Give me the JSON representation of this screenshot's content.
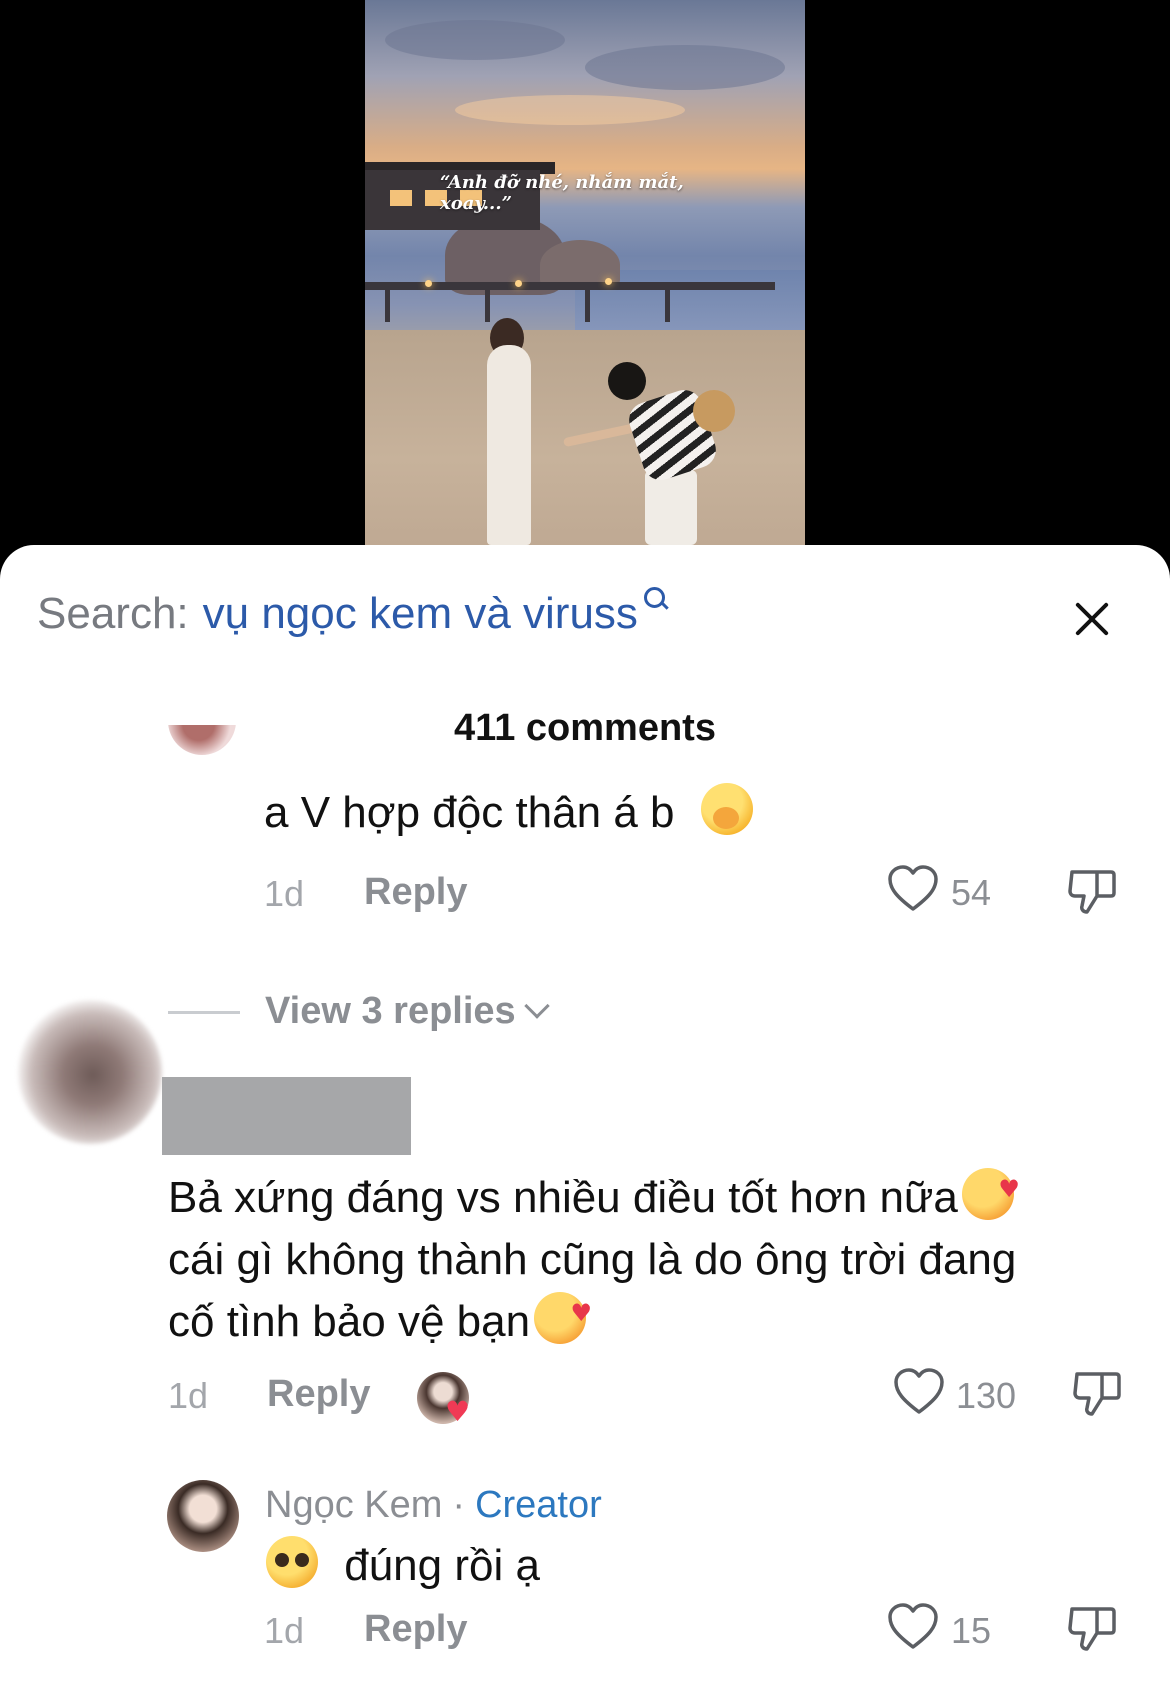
{
  "video": {
    "caption": "“Anh đỡ nhé, nhắm mắt, xoay...”"
  },
  "search": {
    "prefix": "Search:",
    "query": "vụ ngọc kem và viruss"
  },
  "comments_header": {
    "count_label": "411 comments"
  },
  "comments": [
    {
      "text": "a V hợp độc thân á b",
      "emoji": "face-with-hand-over-mouth",
      "time": "1d",
      "reply_label": "Reply",
      "likes": "54"
    },
    {
      "text_line1": "Bả xứng đáng vs nhiều điều tốt hơn nữa",
      "text_line2": "cái gì không thành cũng là do ông trời đang",
      "text_line3": "cố tình bảo vệ bạn",
      "emoji": "smiling-face-with-hearts",
      "time": "1d",
      "reply_label": "Reply",
      "likes": "130"
    }
  ],
  "view_replies": {
    "label": "View 3 replies"
  },
  "creator_reply": {
    "name": "Ngọc Kem",
    "separator": "·",
    "badge": "Creator",
    "text": "đúng rồi ạ",
    "emoji": "pleading-face",
    "time": "1d",
    "reply_label": "Reply",
    "likes": "15"
  },
  "colors": {
    "search_query": "#2c5aa9",
    "creator_badge": "#2c78bf",
    "muted_text": "#8b8e93"
  }
}
